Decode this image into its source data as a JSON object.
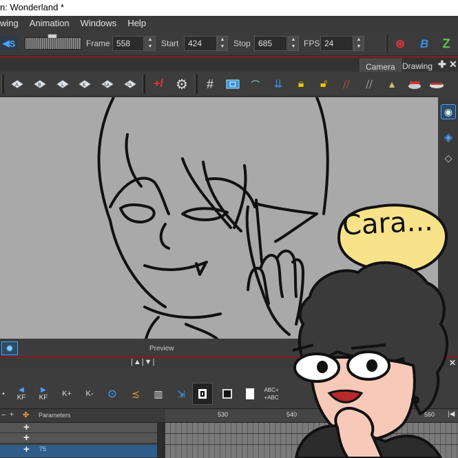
{
  "window": {
    "title": "n: Wonderland *"
  },
  "menubar": {
    "items": [
      "wing",
      "Animation",
      "Windows",
      "Help"
    ]
  },
  "playback": {
    "frame_label": "Frame",
    "frame_value": "558",
    "start_label": "Start",
    "start_value": "424",
    "stop_label": "Stop",
    "stop_value": "685",
    "fps_label": "FPS",
    "fps_value": "24",
    "sound_label": "S"
  },
  "view_tabs": {
    "camera": "Camera",
    "drawing": "Drawing"
  },
  "preview": {
    "label": "Preview"
  },
  "timeline": {
    "buttons": [
      "KF",
      "KF",
      "K+",
      "K-",
      "ABC+\n+ABC"
    ],
    "parameters_label": "Parameters",
    "layer_value": "75",
    "frame_numbers": [
      "530",
      "540",
      "560"
    ]
  },
  "overlay": {
    "speech": "Cara..."
  },
  "colors": {
    "accent_red": "#8a1a1a",
    "accent_blue": "#4aa3ff",
    "bubble": "#f8e38a"
  }
}
